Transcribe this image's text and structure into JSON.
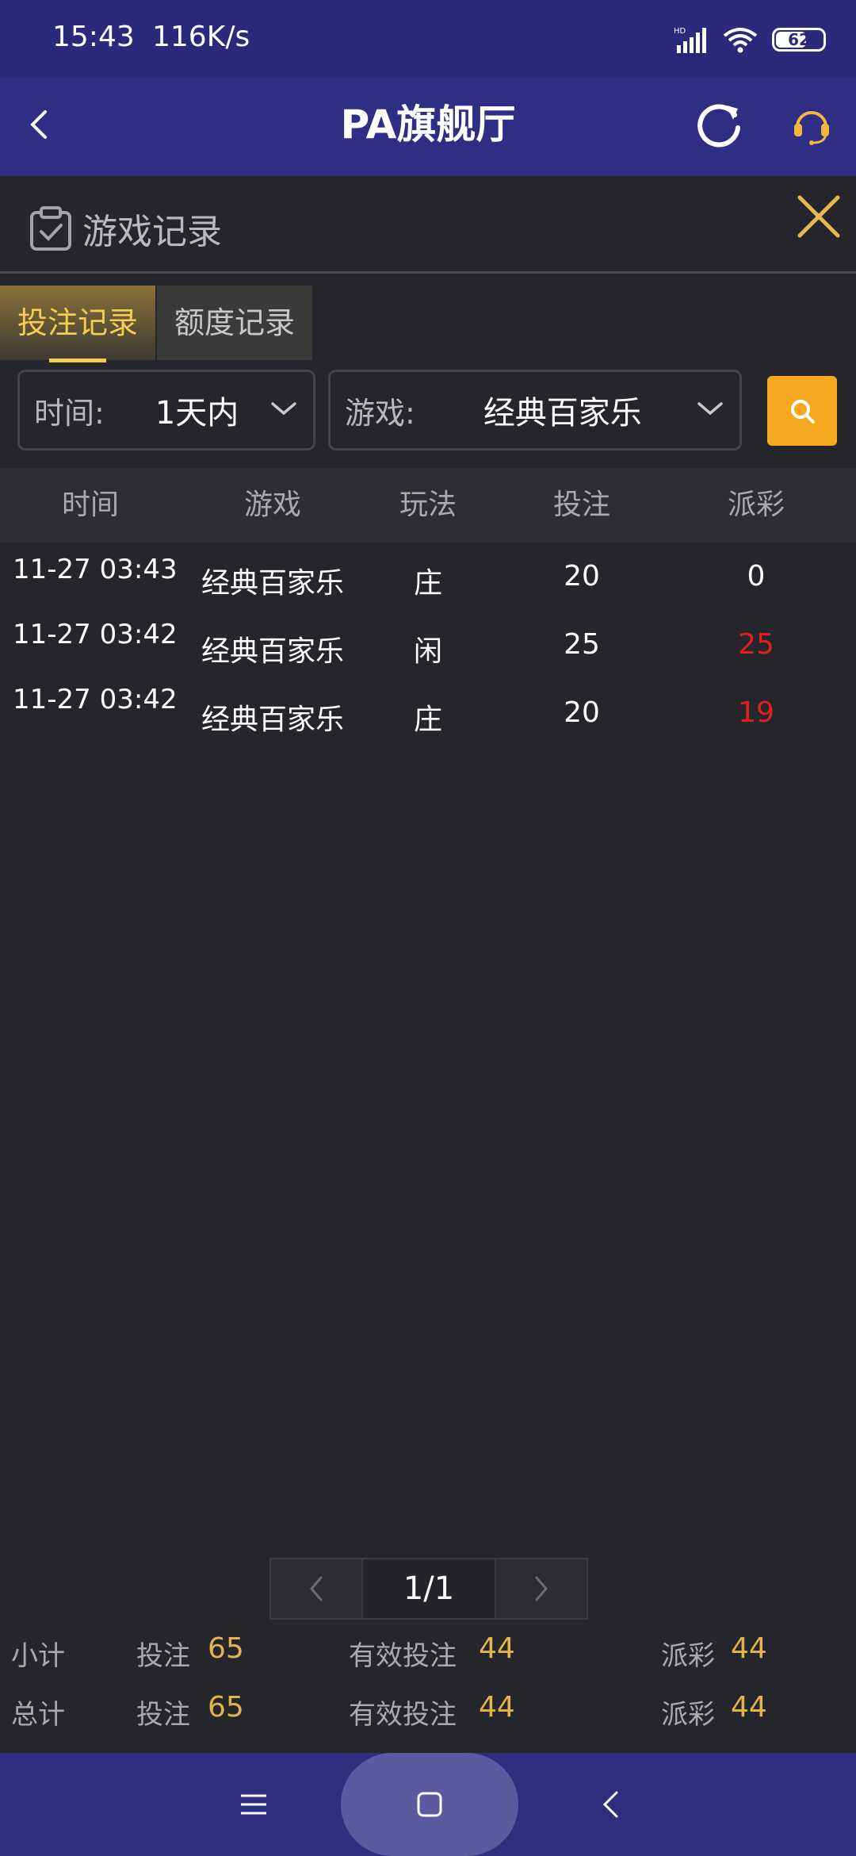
{
  "status_bar": {
    "time": "15:43",
    "network_speed": "116K/s",
    "battery": "62"
  },
  "header": {
    "title": "PA旗舰厅"
  },
  "section": {
    "title": "游戏记录"
  },
  "tabs": [
    {
      "label": "投注记录"
    },
    {
      "label": "额度记录"
    }
  ],
  "filters": {
    "time": {
      "label": "时间:",
      "value": "1天内"
    },
    "game": {
      "label": "游戏:",
      "value": "经典百家乐"
    }
  },
  "table": {
    "headers": [
      "时间",
      "游戏",
      "玩法",
      "投注",
      "派彩"
    ],
    "rows": [
      {
        "time": "11-27 03:43",
        "game": "经典百家乐",
        "play": "庄",
        "bet": "20",
        "payout": "0"
      },
      {
        "time": "11-27 03:42",
        "game": "经典百家乐",
        "play": "闲",
        "bet": "25",
        "payout": "25"
      },
      {
        "time": "11-27 03:42",
        "game": "经典百家乐",
        "play": "庄",
        "bet": "20",
        "payout": "19"
      }
    ]
  },
  "pagination": {
    "page": "1/1"
  },
  "totals": {
    "subtotal": {
      "label": "小计",
      "bet_label": "投注",
      "bet": "65",
      "valid_label": "有效投注",
      "valid": "44",
      "payout_label": "派彩",
      "payout": "44"
    },
    "total": {
      "label": "总计",
      "bet_label": "投注",
      "bet": "65",
      "valid_label": "有效投注",
      "valid": "44",
      "payout_label": "派彩",
      "payout": "44"
    }
  },
  "colors": {
    "accent_gold": "#f3cd56",
    "search_orange": "#f6a820",
    "payout_red": "#e02020",
    "header_blue": "#2e2e84"
  },
  "icons": {
    "back": "back-arrow-icon",
    "refresh": "refresh-icon",
    "support": "headset-icon",
    "close": "close-icon",
    "search": "search-icon"
  }
}
